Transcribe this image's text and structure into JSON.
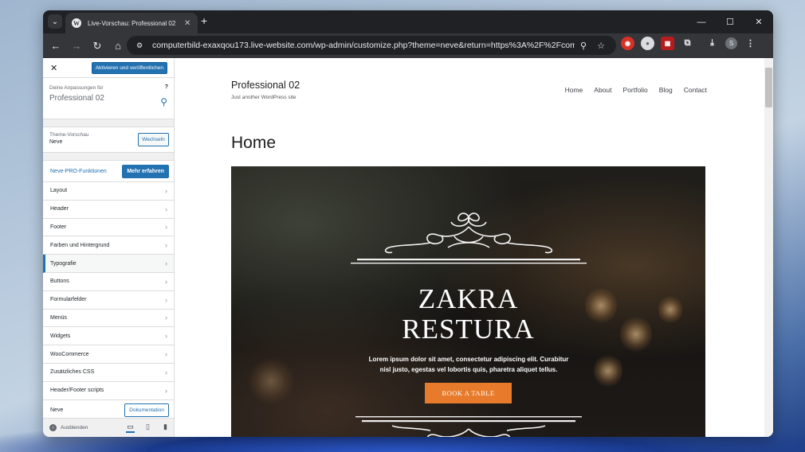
{
  "browser": {
    "tab_title": "Live-Vorschau: Professional 02",
    "url": "computerbild-exaxqou173.live-website.com/wp-admin/customize.php?theme=neve&return=https%3A%2F%2Fcomputer...",
    "profile_initial": "S"
  },
  "customizer": {
    "publish_label": "Aktivieren und veröffentlichen",
    "info_label": "Deine Anpassungen für",
    "info_title": "Professional 02",
    "theme_label": "Theme-Vorschau",
    "theme_name": "Neve",
    "switch_label": "Wechseln",
    "pro_label": "Neve-PRO-Funktionen",
    "pro_button": "Mehr erfahren",
    "items": [
      {
        "label": "Layout"
      },
      {
        "label": "Header"
      },
      {
        "label": "Footer"
      },
      {
        "label": "Farben und Hintergrund"
      },
      {
        "label": "Typografie"
      },
      {
        "label": "Buttons"
      },
      {
        "label": "Formularfelder"
      },
      {
        "label": "Menüs"
      },
      {
        "label": "Widgets"
      },
      {
        "label": "WooCommerce"
      },
      {
        "label": "Zusätzliches CSS"
      },
      {
        "label": "Header/Footer scripts"
      }
    ],
    "active_item": "Typografie",
    "neve_label": "Neve",
    "doc_button": "Dokumentation",
    "hide_label": "Ausblenden"
  },
  "site": {
    "title": "Professional 02",
    "tagline": "Just another WordPress site",
    "nav": [
      "Home",
      "About",
      "Portfolio",
      "Blog",
      "Contact"
    ],
    "page_title": "Home",
    "hero": {
      "title_line1": "ZAKRA",
      "title_line2": "RESTURA",
      "text": "Lorem ipsum dolor sit amet, consectetur adipiscing elit. Curabitur nisl justo, egestas vel lobortis quis, pharetra aliquet tellus.",
      "button": "BOOK A TABLE",
      "button_color": "#e87b2b"
    }
  },
  "colors": {
    "accent": "#2271b1"
  }
}
